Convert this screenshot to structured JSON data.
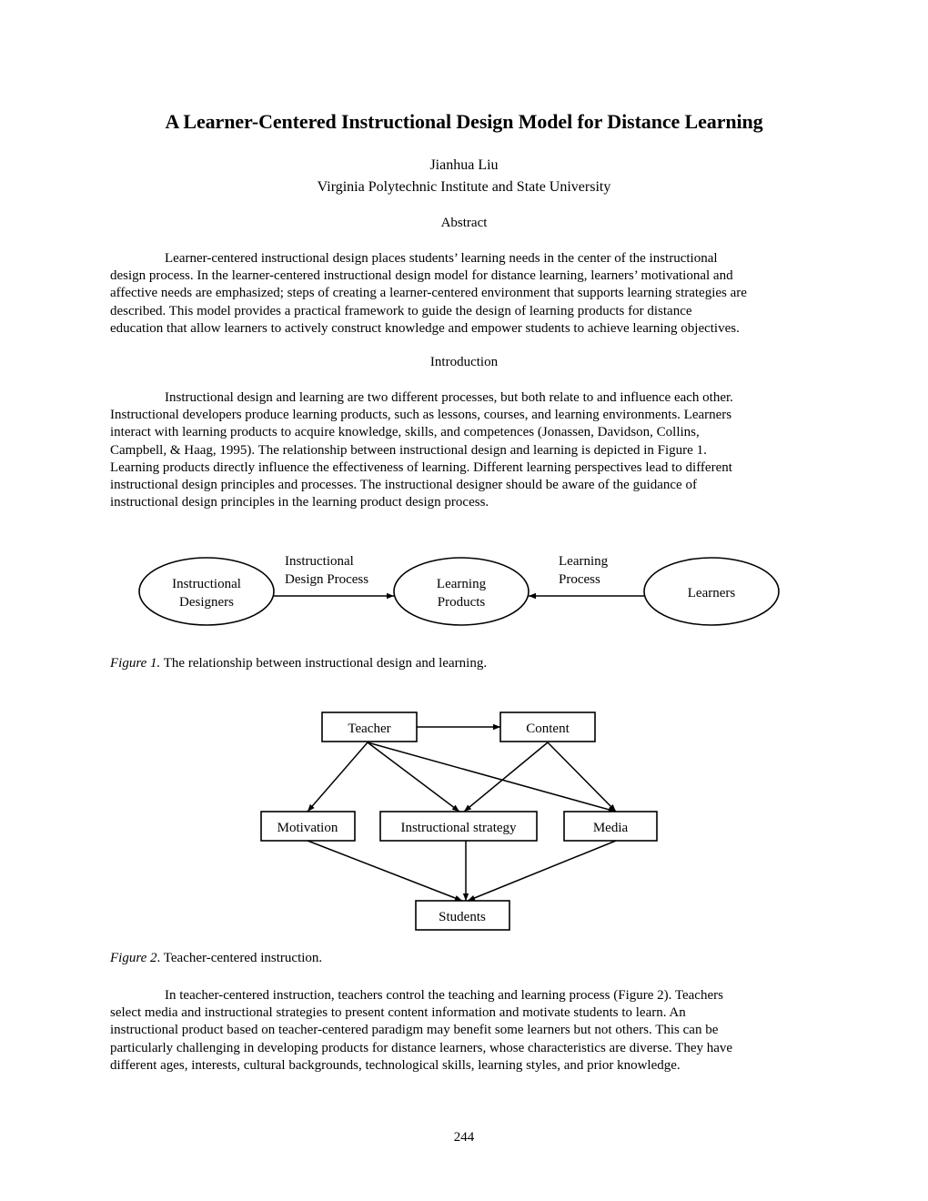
{
  "header": {
    "title": "A Learner-Centered Instructional Design Model for Distance Learning",
    "author": "Jianhua Liu",
    "affiliation": "Virginia Polytechnic Institute and State University"
  },
  "abstract": {
    "heading": "Abstract",
    "lines": [
      "Learner-centered instructional design places students’ learning needs in the center of the instructional",
      "design process. In the learner-centered instructional design model for distance learning, learners’ motivational and",
      "affective needs are emphasized; steps of creating a learner-centered environment that supports learning strategies are",
      "described.  This model provides a practical framework to guide the design of learning products for distance",
      "education that allow learners to actively construct knowledge and empower students to achieve learning objectives."
    ]
  },
  "introduction": {
    "heading": "Introduction",
    "lines": [
      "Instructional design and learning are two different processes, but both relate to and influence each other.",
      "Instructional developers produce learning products, such as lessons, courses, and learning environments. Learners",
      "interact with learning products to acquire knowledge, skills, and competences (Jonassen, Davidson, Collins,",
      "Campbell, & Haag, 1995). The relationship between instructional design and learning is depicted in Figure 1.",
      "Learning products directly influence the effectiveness of learning. Different learning perspectives lead to different",
      "instructional design principles and processes. The instructional designer should be aware of the guidance of",
      "instructional design principles in the learning product design process."
    ]
  },
  "figure1": {
    "nodes": {
      "designers": [
        "Instructional",
        "Designers"
      ],
      "products": [
        "Learning",
        "Products"
      ],
      "learners": [
        "Learners"
      ]
    },
    "edges": {
      "design_process": [
        "Instructional",
        "Design Process"
      ],
      "learning_process": [
        "Learning",
        "Process"
      ]
    },
    "caption_label": "Figure 1.",
    "caption_text": " The relationship between instructional design and learning."
  },
  "figure2": {
    "nodes": {
      "teacher": "Teacher",
      "content": "Content",
      "motivation": "Motivation",
      "strategy": "Instructional strategy",
      "media": "Media",
      "students": "Students"
    },
    "caption_label": "Figure 2",
    "caption_text": ". Teacher-centered instruction."
  },
  "body": {
    "lines": [
      "In teacher-centered instruction, teachers control the teaching and learning process (Figure 2). Teachers",
      "select media and instructional strategies to present content information and motivate students to learn. An",
      "instructional product based on teacher-centered paradigm may benefit some learners but not others. This can be",
      "particularly challenging in developing products for distance learners, whose characteristics are diverse. They have",
      "different ages, interests, cultural backgrounds, technological skills, learning styles, and prior knowledge."
    ]
  },
  "footer": {
    "page_number": "244"
  }
}
